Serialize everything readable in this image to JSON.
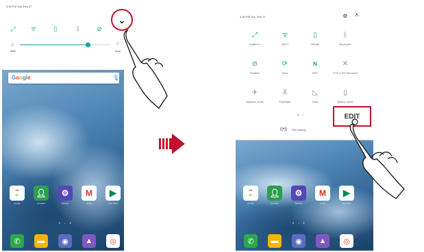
{
  "left_phone": {
    "status": {
      "time_date": "4:35 PM Tue, Feb 27"
    },
    "quick_icons": [
      "screen-capture-icon",
      "wifi-icon",
      "vibrate-icon",
      "bluetooth-icon",
      "rotation-icon"
    ],
    "brightness": {
      "level": 0.75,
      "auto_label": "Auto",
      "value_label": "88%"
    },
    "search": {
      "logo": "Google"
    },
    "apps": [
      {
        "label": "Google",
        "icon": "google-folder-icon",
        "color": "#ffffff"
      },
      {
        "label": "Contacts",
        "icon": "contacts-icon",
        "color": "#2e9e4f"
      },
      {
        "label": "Settings",
        "icon": "settings-icon",
        "color": "#5546b8"
      },
      {
        "label": "Gmail",
        "icon": "gmail-icon",
        "color": "#ffffff"
      },
      {
        "label": "Play Store",
        "icon": "play-store-icon",
        "color": "#ffffff"
      }
    ],
    "dock": [
      {
        "icon": "phone-icon",
        "color": "#2aa84a",
        "glyph": "✆"
      },
      {
        "icon": "messages-icon",
        "color": "#f4b400",
        "glyph": "▬"
      },
      {
        "icon": "camera-icon",
        "color": "#5c6bc0",
        "glyph": "◉"
      },
      {
        "icon": "gallery-icon",
        "color": "#7e57c2",
        "glyph": "▲"
      },
      {
        "icon": "chrome-icon",
        "color": "#ffffff",
        "glyph": "◎"
      }
    ],
    "page_dots": "• ◦ •"
  },
  "right_phone": {
    "status": {
      "time_date": "4:35 PM Tue, Feb 27"
    },
    "tiles": [
      {
        "label": "Capture+",
        "icon": "capture-plus-icon",
        "glyph": "⤢",
        "on": true
      },
      {
        "label": "Wi-Fi",
        "icon": "wifi-icon",
        "glyph": "ᯤ",
        "on": true
      },
      {
        "label": "Vibrate",
        "icon": "vibrate-icon",
        "glyph": "▯",
        "on": true
      },
      {
        "label": "Bluetooth",
        "icon": "bluetooth-icon",
        "glyph": "ᛒ",
        "on": false
      },
      {
        "label": "Rotation",
        "icon": "rotation-icon",
        "glyph": "⊘",
        "on": true
      },
      {
        "label": "Sync",
        "icon": "sync-icon",
        "glyph": "⟳",
        "on": true
      },
      {
        "label": "NFC",
        "icon": "nfc-icon",
        "glyph": "N",
        "on": true
      },
      {
        "label": "DTS:X 3D Surround",
        "icon": "surround-icon",
        "glyph": "✕",
        "on": false
      },
      {
        "label": "Airplane mode",
        "icon": "airplane-icon",
        "glyph": "✈",
        "on": false
      },
      {
        "label": "Flashlight",
        "icon": "flashlight-icon",
        "glyph": "⊼",
        "on": false
      },
      {
        "label": "Data",
        "icon": "data-icon",
        "glyph": "◺",
        "on": false
      },
      {
        "label": "Battery saver",
        "icon": "battery-saver-icon",
        "glyph": "▯",
        "on": false
      }
    ],
    "edit_label": "EDIT",
    "file_sharing_label": "File sharing",
    "pager": "• ◦"
  },
  "colors": {
    "accent": "#16a0a0",
    "highlight": "#c0102c"
  }
}
